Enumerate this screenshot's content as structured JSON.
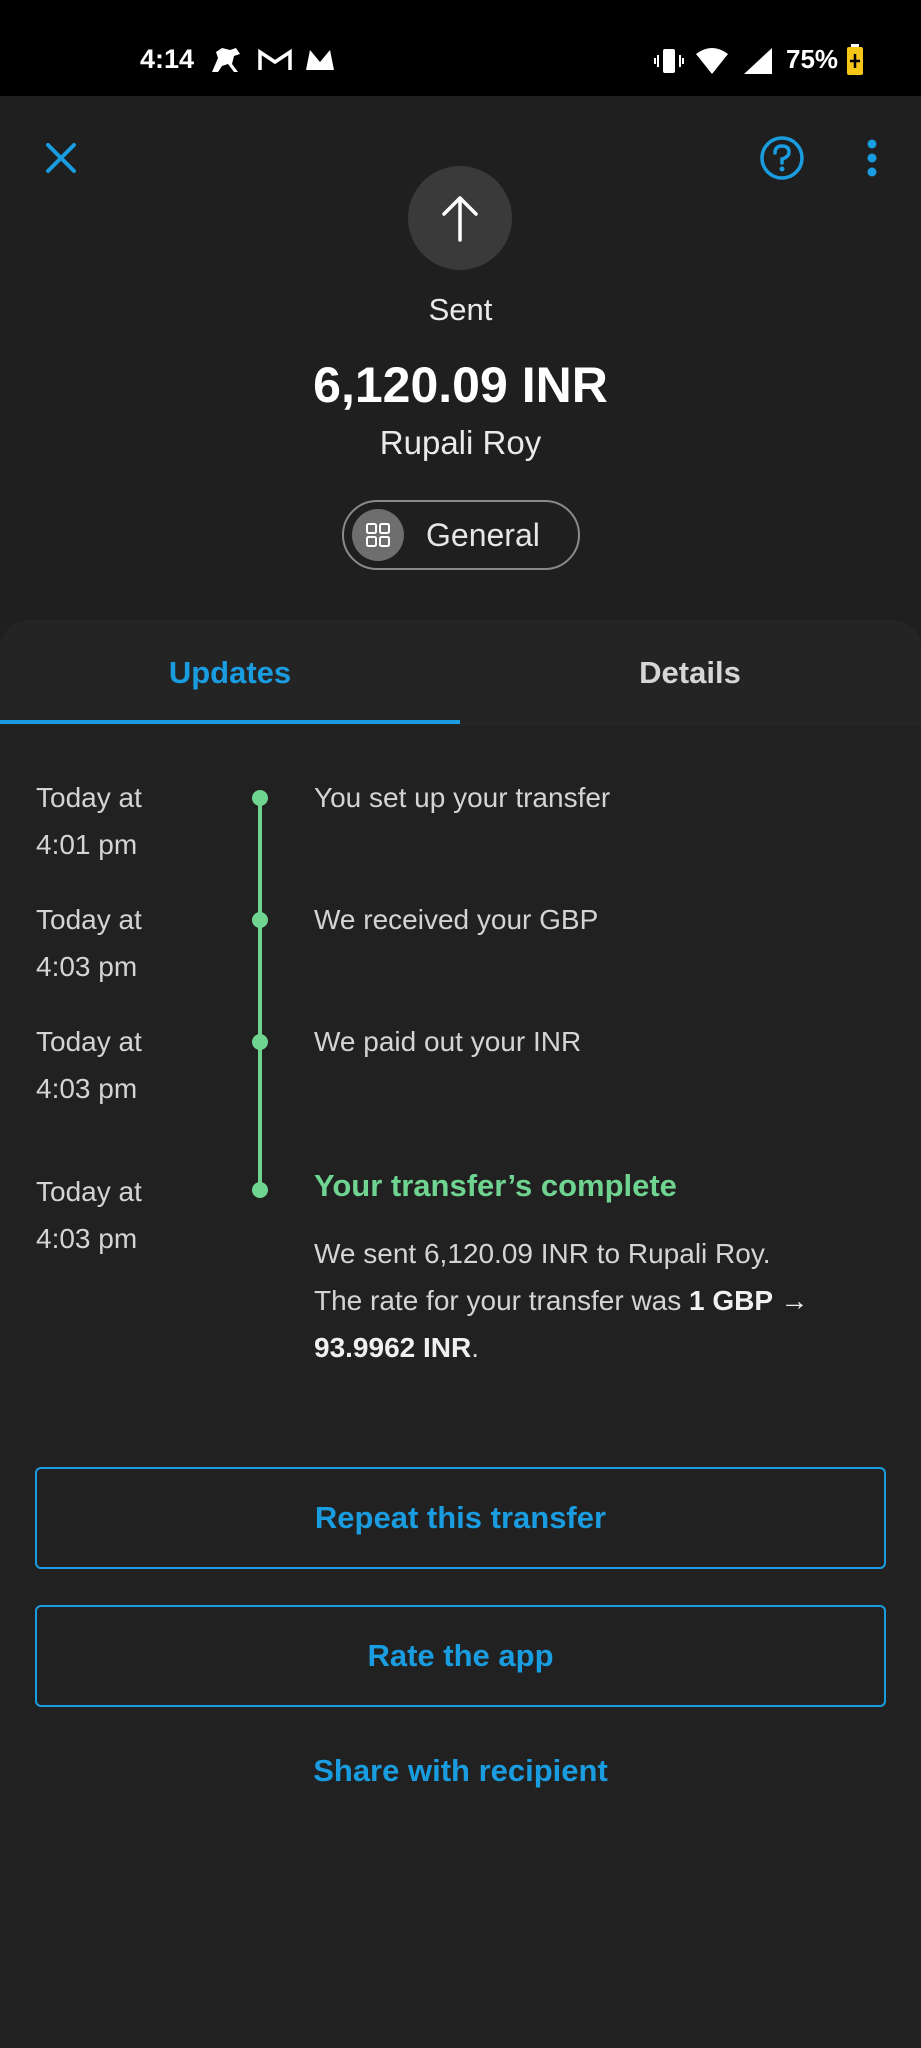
{
  "status_bar": {
    "time": "4:14",
    "battery": "75%",
    "icons": [
      "horse-icon",
      "gmail-icon",
      "m-app-icon",
      "vibrate-icon",
      "wifi-icon",
      "signal-icon",
      "battery-icon"
    ]
  },
  "header": {
    "close_icon": "close-icon",
    "help_icon": "help-icon",
    "more_icon": "more-vertical-icon",
    "status_label": "Sent",
    "amount": "6,120.09 INR",
    "recipient": "Rupali Roy",
    "category": "General"
  },
  "tabs": {
    "updates": "Updates",
    "details": "Details",
    "active": "Updates"
  },
  "timeline": [
    {
      "time_line1": "Today at",
      "time_line2": "4:01 pm",
      "text": "You set up your transfer"
    },
    {
      "time_line1": "Today at",
      "time_line2": "4:03 pm",
      "text": "We received your GBP"
    },
    {
      "time_line1": "Today at",
      "time_line2": "4:03 pm",
      "text": "We paid out your INR"
    },
    {
      "time_line1": "Today at",
      "time_line2": "4:03 pm",
      "title": "Your transfer’s complete",
      "body_line1": "We sent 6,120.09 INR to Rupali Roy.",
      "body_line2_prefix": "The rate for your transfer was ",
      "body_rate_a": "1 GBP →",
      "body_rate_b": "93.9962 INR",
      "body_suffix": "."
    }
  ],
  "actions": {
    "repeat": "Repeat this transfer",
    "rate": "Rate the app",
    "share": "Share with recipient"
  },
  "colors": {
    "accent": "#1a9de0",
    "success": "#6fd490",
    "background": "#1f1f1f"
  }
}
